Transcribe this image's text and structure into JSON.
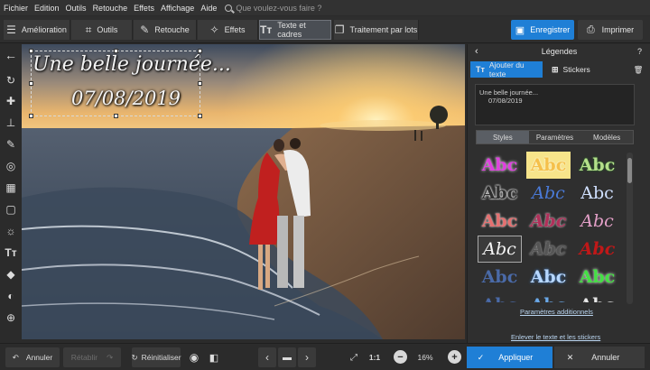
{
  "menu": [
    "Fichier",
    "Edition",
    "Outils",
    "Retouche",
    "Effets",
    "Affichage",
    "Aide"
  ],
  "search": {
    "placeholder": "Que voulez-vous faire ?"
  },
  "toolbar": {
    "tabs": [
      "Amélioration",
      "Outils",
      "Retouche",
      "Effets",
      "Texte et cadres",
      "Traitement par lots"
    ],
    "active_tab": "Texte et cadres",
    "save_label": "Enregistrer",
    "print_label": "Imprimer"
  },
  "left_tools": [
    "back-arrow-icon",
    "rotate-icon",
    "healing-icon",
    "stamp-icon",
    "brush-icon",
    "radial-icon",
    "gradient-icon",
    "vignette-icon",
    "sun-icon",
    "text-icon",
    "fill-icon",
    "recolor-icon",
    "crosshair-icon"
  ],
  "canvas": {
    "caption_line1": "Une belle journée...",
    "caption_line2": "07/08/2019"
  },
  "panel": {
    "title": "Légendes",
    "help": "?",
    "tab_add_text": "Ajouter du texte",
    "tab_stickers": "Stickers",
    "text_line1": "Une belle journée...",
    "text_line2": "07/08/2019",
    "segments": [
      "Styles",
      "Paramètres",
      "Modèles"
    ],
    "active_segment": "Styles",
    "style_sample": "Abc",
    "more_settings_link": "Paramètres additionnels",
    "remove_link": "Enlever le texte et les stickers"
  },
  "bottom": {
    "undo": "Annuler",
    "redo": "Rétablir",
    "reset": "Réinitialiser",
    "zoom_ratio": "1:1",
    "zoom_percent": "16%",
    "apply": "Appliquer",
    "cancel": "Annuler"
  },
  "colors": {
    "accent": "#1f7fd6",
    "bg": "#2b2b2b",
    "panel": "#2f2f2f"
  }
}
